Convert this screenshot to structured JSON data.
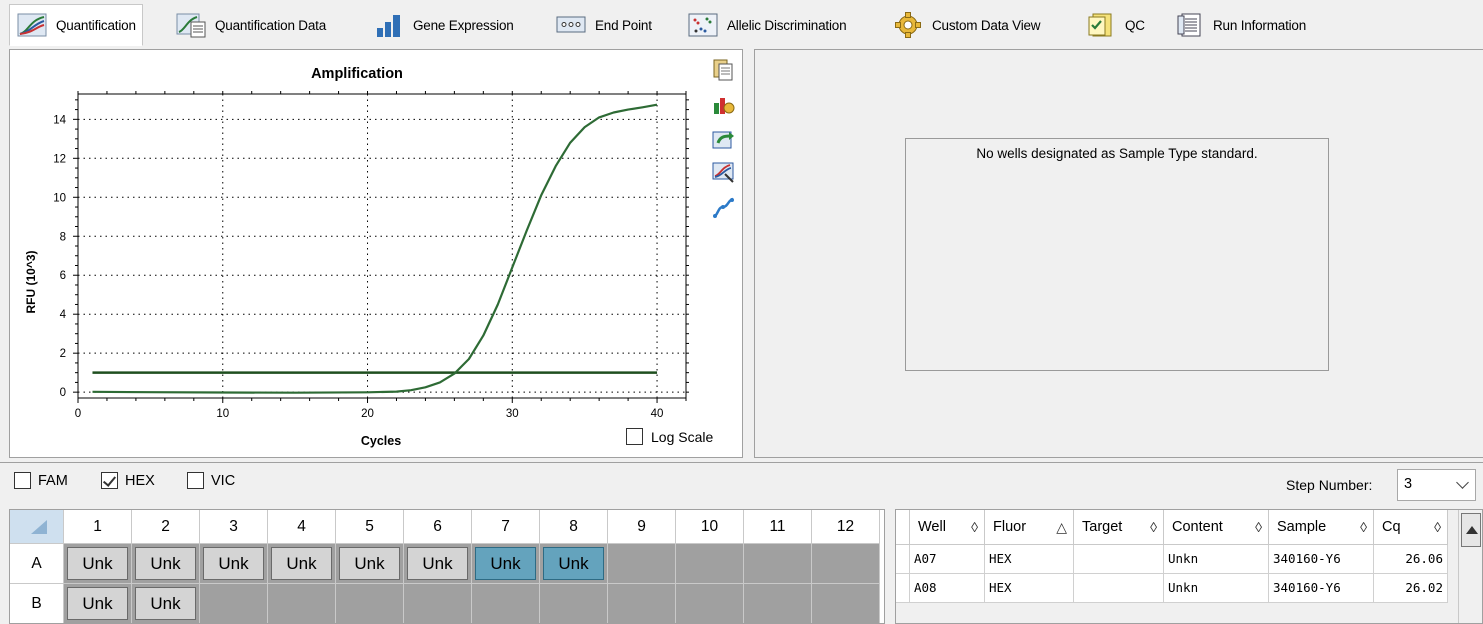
{
  "tabs": [
    {
      "label": "Quantification",
      "icon": "amplification-curve-icon",
      "active": true
    },
    {
      "label": "Quantification Data",
      "icon": "quantification-data-icon"
    },
    {
      "label": "Gene Expression",
      "icon": "bar-chart-icon"
    },
    {
      "label": "End Point",
      "icon": "end-point-icon"
    },
    {
      "label": "Allelic Discrimination",
      "icon": "scatter-plot-icon"
    },
    {
      "label": "Custom Data View",
      "icon": "gear-icon"
    },
    {
      "label": "QC",
      "icon": "checklist-icon"
    },
    {
      "label": "Run Information",
      "icon": "document-icon"
    }
  ],
  "chart_data": {
    "type": "line",
    "title": "Amplification",
    "xlabel": "Cycles",
    "ylabel": "RFU (10^3)",
    "xlim": [
      0,
      42
    ],
    "ylim": [
      -0.3,
      15.3
    ],
    "x_ticks": [
      0,
      10,
      20,
      30,
      40
    ],
    "y_ticks": [
      0,
      2,
      4,
      6,
      8,
      10,
      12,
      14
    ],
    "grid": true,
    "threshold": 1.0,
    "series": [
      {
        "color": "#2e6b35",
        "x": [
          1,
          5,
          10,
          15,
          20,
          22,
          23,
          24,
          25,
          26,
          27,
          28,
          29,
          30,
          31,
          32,
          33,
          34,
          35,
          36,
          37,
          38,
          39,
          40
        ],
        "y": [
          0.02,
          0.0,
          -0.02,
          -0.03,
          -0.01,
          0.03,
          0.1,
          0.25,
          0.5,
          0.95,
          1.7,
          2.9,
          4.5,
          6.4,
          8.3,
          10.1,
          11.6,
          12.8,
          13.6,
          14.1,
          14.35,
          14.5,
          14.62,
          14.75
        ]
      }
    ]
  },
  "chart_controls": {
    "log_scale_label": "Log Scale",
    "log_scale_checked": false,
    "tools": [
      "copy-icon",
      "chart-settings-icon",
      "export-icon",
      "zoom-chart-icon",
      "curve-fit-icon"
    ]
  },
  "standard_curve": {
    "message": "No wells designated as Sample Type standard."
  },
  "fluors": [
    {
      "label": "FAM",
      "checked": false
    },
    {
      "label": "HEX",
      "checked": true
    },
    {
      "label": "VIC",
      "checked": false
    }
  ],
  "step": {
    "label": "Step Number:",
    "value": "3"
  },
  "plate": {
    "columns": [
      "1",
      "2",
      "3",
      "4",
      "5",
      "6",
      "7",
      "8",
      "9",
      "10",
      "11",
      "12"
    ],
    "rows": [
      {
        "label": "A",
        "wells": [
          "Unk",
          "Unk",
          "Unk",
          "Unk",
          "Unk",
          "Unk",
          "Unk",
          "Unk",
          "",
          "",
          "",
          ""
        ],
        "selected": [
          7,
          8
        ]
      },
      {
        "label": "B",
        "wells": [
          "Unk",
          "Unk",
          "",
          "",
          "",
          "",
          "",
          "",
          "",
          "",
          "",
          ""
        ],
        "selected": []
      }
    ]
  },
  "results": {
    "columns": [
      {
        "label": "Well",
        "sort": "◊"
      },
      {
        "label": "Fluor",
        "sort": "△"
      },
      {
        "label": "Target",
        "sort": "◊"
      },
      {
        "label": "Content",
        "sort": "◊"
      },
      {
        "label": "Sample",
        "sort": "◊"
      },
      {
        "label": "Cq",
        "sort": "◊"
      }
    ],
    "rows": [
      [
        "A07",
        "HEX",
        "",
        "Unkn",
        "340160-Y6",
        "26.06"
      ],
      [
        "A08",
        "HEX",
        "",
        "Unkn",
        "340160-Y6",
        "26.02"
      ]
    ]
  }
}
